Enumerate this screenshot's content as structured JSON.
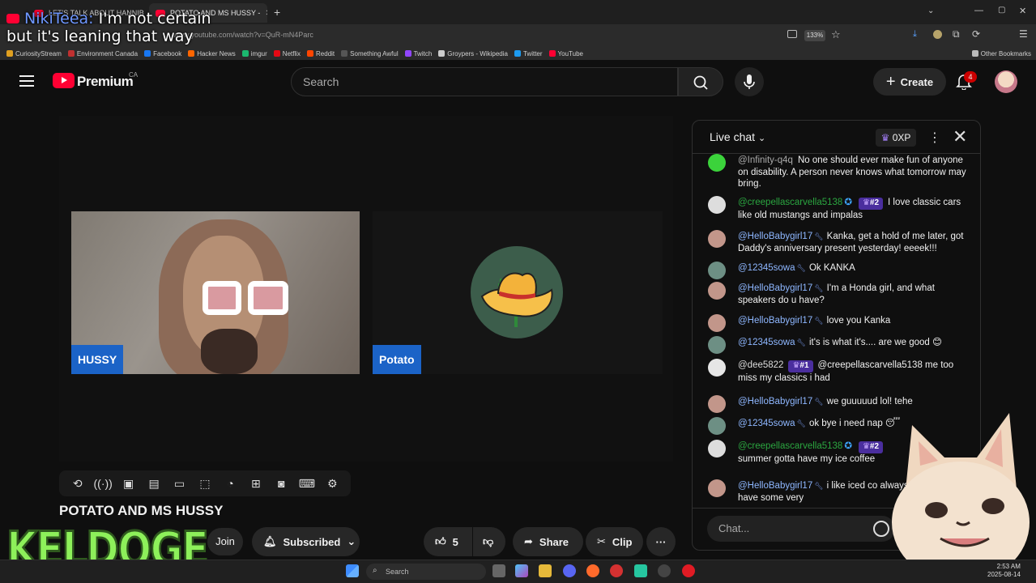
{
  "browser": {
    "tabs": [
      {
        "label": "LET'S TALK ABOUT HANNIB"
      },
      {
        "label": "POTATO AND MS HUSSY -"
      }
    ],
    "url": "www.youtube.com/watch?v=QuR-mN4Parc",
    "zoom": "133%",
    "bookmarks": [
      {
        "label": "CuriosityStream",
        "color": "#e0a020"
      },
      {
        "label": "Environment Canada",
        "color": "#c03030"
      },
      {
        "label": "Facebook",
        "color": "#1877f2"
      },
      {
        "label": "Hacker News",
        "color": "#ff6600"
      },
      {
        "label": "imgur",
        "color": "#1bb76e"
      },
      {
        "label": "Netflix",
        "color": "#e50914"
      },
      {
        "label": "Reddit",
        "color": "#ff4500"
      },
      {
        "label": "Something Awful",
        "color": "#333333"
      },
      {
        "label": "Twitch",
        "color": "#9146ff"
      },
      {
        "label": "Groypers - Wikipedia",
        "color": "#cccccc"
      },
      {
        "label": "Twitter",
        "color": "#1d9bf0"
      },
      {
        "label": "YouTube",
        "color": "#ff0033"
      }
    ],
    "other_bookmarks": "Other Bookmarks"
  },
  "caption": {
    "name": "NikiTeea:",
    "line1": " I'm not certain",
    "line2": "but it's leaning that way"
  },
  "header": {
    "logo_text": "Premium",
    "region": "CA",
    "search_placeholder": "Search",
    "create_label": "Create",
    "notification_count": "4"
  },
  "video": {
    "participants": [
      {
        "label": "HUSSY"
      },
      {
        "label": "Potato"
      }
    ],
    "title": "POTATO AND MS HUSSY",
    "overlay_text": "KELDOGE"
  },
  "actions": {
    "join": "Join",
    "subscribed": "Subscribed",
    "likes": "5",
    "share": "Share",
    "clip": "Clip"
  },
  "chat": {
    "title": "Live chat",
    "xp": "0XP",
    "input_placeholder": "Chat...",
    "messages": [
      {
        "author": "@Infinity-q4q",
        "text": "No one should ever make fun of anyone on disability. A person never knows what tomorrow may bring."
      },
      {
        "author": "@creepellascarvella5138",
        "rank": "#2",
        "text": "I love classic cars like old mustangs and impalas"
      },
      {
        "author": "@HelloBabygirl17",
        "text": "Kanka, get a hold of me later, got Daddy's anniversary present yesterday! eeeek!!!"
      },
      {
        "author": "@12345sowa",
        "text": "Ok KANKA"
      },
      {
        "author": "@HelloBabygirl17",
        "text": "I'm a Honda girl, and what speakers do u have?"
      },
      {
        "author": "@HelloBabygirl17",
        "text": "love you Kanka"
      },
      {
        "author": "@12345sowa",
        "text": "it's is what it's.... are we good 😊"
      },
      {
        "author": "@dee5822",
        "rank": "#1",
        "text": "@creepellascarvella5138 me too miss my classics i had"
      },
      {
        "author": "@HelloBabygirl17",
        "text": "we guuuuud lol! tehe"
      },
      {
        "author": "@12345sowa",
        "text": "ok bye i need nap 😴"
      },
      {
        "author": "@creepellascarvella5138",
        "rank": "#2",
        "text": "summer gotta have my ice coffee"
      },
      {
        "author": "@HelloBabygirl17",
        "text": "i like iced co always liked tea... i have some very"
      }
    ]
  },
  "taskbar": {
    "search": "Search",
    "time": "2:53 AM",
    "date": "2025-08-14"
  }
}
